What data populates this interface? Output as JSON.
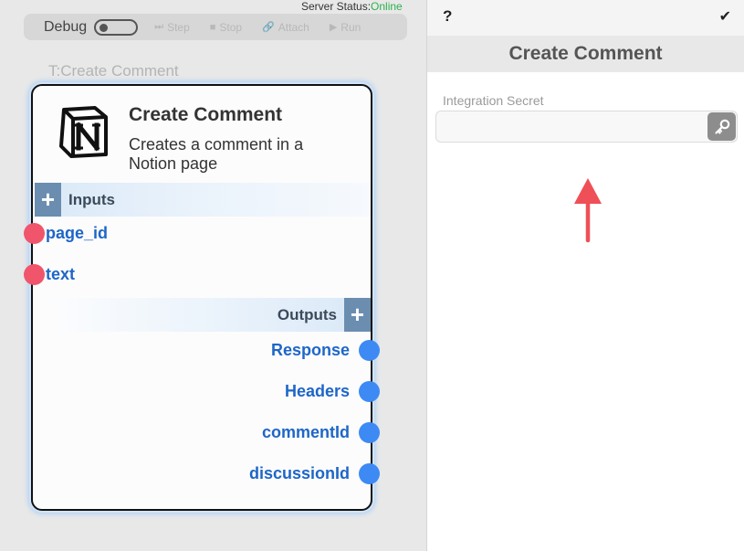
{
  "server_status": {
    "label": "Server Status:",
    "value": "Online",
    "value_color": "#2bb24c"
  },
  "toolbar": {
    "debug_label": "Debug",
    "debug_enabled": false,
    "buttons": [
      {
        "label": "Step",
        "icon": "step-icon"
      },
      {
        "label": "Stop",
        "icon": "stop-icon"
      },
      {
        "label": "Attach",
        "icon": "link-icon"
      },
      {
        "label": "Run",
        "icon": "play-icon"
      }
    ]
  },
  "node": {
    "tag": "T:Create Comment",
    "logo": "notion-logo",
    "title": "Create Comment",
    "description": "Creates a comment in a Notion page",
    "inputs_label": "Inputs",
    "inputs": [
      "page_id",
      "text"
    ],
    "outputs_label": "Outputs",
    "outputs": [
      "Response",
      "Headers",
      "commentId",
      "discussionId"
    ],
    "input_port_color": "#f0556b",
    "output_port_color": "#3d8af5"
  },
  "panel": {
    "help_label": "?",
    "confirm_label": "✔",
    "title": "Create Comment",
    "integration_secret": {
      "label": "Integration Secret",
      "value": "",
      "placeholder": ""
    },
    "key_icon": "key-icon"
  }
}
